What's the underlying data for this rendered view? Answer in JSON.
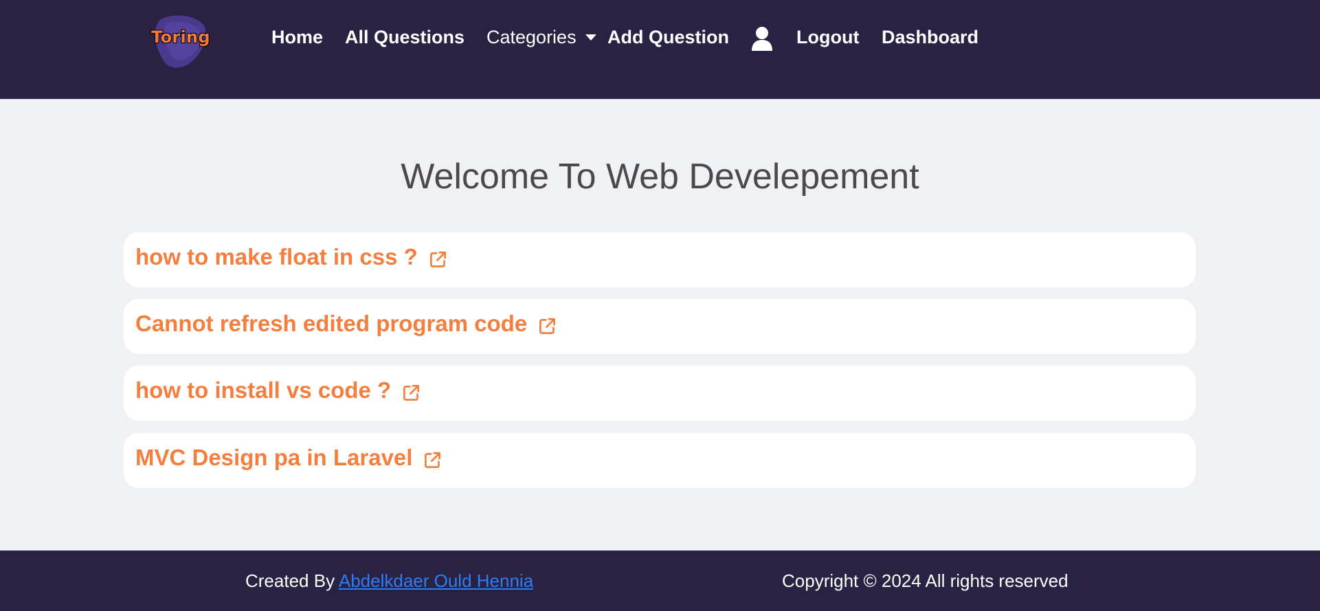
{
  "brand": {
    "logo_text": "Toring"
  },
  "nav": {
    "home": "Home",
    "all_questions": "All Questions",
    "categories": "Categories",
    "add_question": "Add Question",
    "logout": "Logout",
    "dashboard": "Dashboard"
  },
  "main": {
    "title": "Welcome To Web Develepement",
    "questions": [
      {
        "title": "how to make float in css ?"
      },
      {
        "title": "Cannot refresh edited program code"
      },
      {
        "title": "how to install vs code ?"
      },
      {
        "title": "MVC Design pa in Laravel"
      }
    ]
  },
  "footer": {
    "created_by": "Created By ",
    "author": "Abdelkdaer Ould Hennia",
    "copyright": "Copyright © 2024 All rights reserved"
  },
  "colors": {
    "navbar_bg": "#2a2242",
    "page_bg": "#f0f1f5",
    "accent_orange": "#f47e3e",
    "link_blue": "#2e7cf6",
    "logo_purple": "#4a3a8e"
  },
  "icons": {
    "user": "user-icon",
    "dropdown": "caret-down-icon",
    "external_link": "external-link-icon"
  }
}
